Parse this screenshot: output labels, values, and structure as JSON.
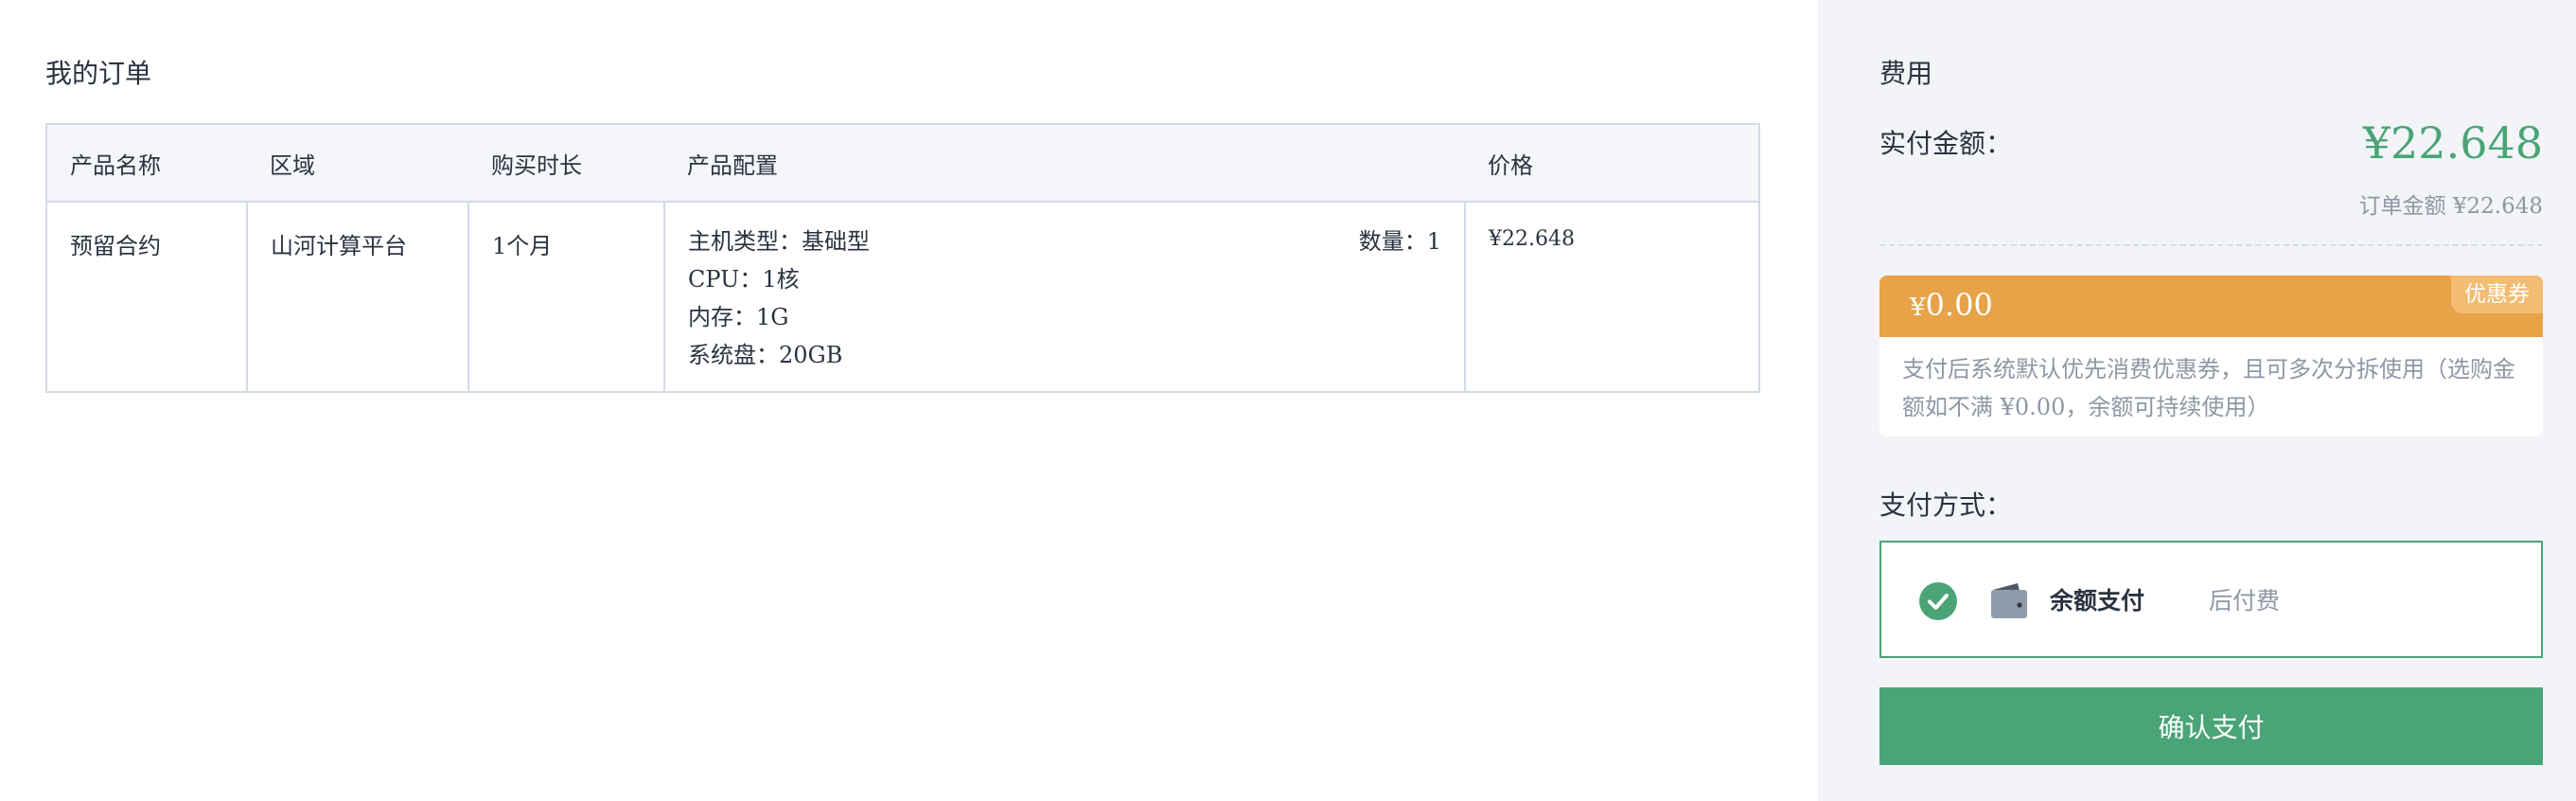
{
  "order": {
    "title": "我的订单",
    "columns": [
      "产品名称",
      "区域",
      "购买时长",
      "产品配置",
      "价格"
    ],
    "rows": [
      {
        "product_name": "预留合约",
        "region": "山河计算平台",
        "duration": "1个月",
        "config": {
          "host_type": "主机类型：基础型",
          "quantity": "数量：1",
          "cpu": "CPU：1核",
          "memory": "内存：1G",
          "disk": "系统盘：20GB"
        },
        "price": "¥22.648"
      }
    ]
  },
  "checkout": {
    "title": "费用",
    "pay_label": "实付金额：",
    "pay_amount": "¥22.648",
    "order_amount": "订单金额 ¥22.648",
    "coupon": {
      "currency": "¥",
      "amount": "0.00",
      "tag": "优惠券",
      "note": "支付后系统默认优先消费优惠券，且可多次分拆使用（选购金额如不满 ¥0.00，余额可持续使用）"
    },
    "payment_method": {
      "title": "支付方式：",
      "name": "余额支付",
      "sub": "后付费",
      "selected": true
    },
    "confirm_button": "确认支付"
  },
  "colors": {
    "accent_green": "#4aa477",
    "coupon_orange": "#e8a248",
    "coupon_tag": "#f2bc72",
    "muted_text": "#8e97a4",
    "table_border": "#d3dbe6",
    "side_bg": "#f2f4f8"
  },
  "icons": {
    "check": "check-circle-icon",
    "wallet": "wallet-icon"
  }
}
